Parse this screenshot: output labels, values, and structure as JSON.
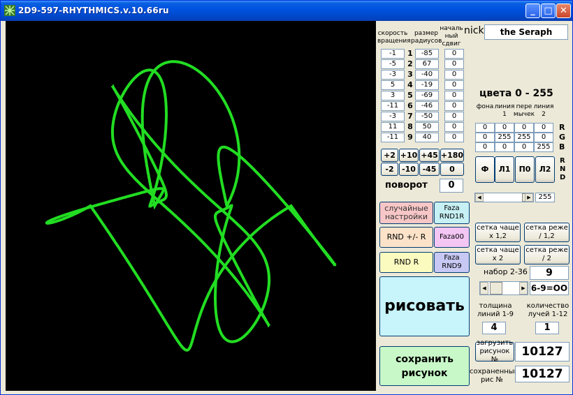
{
  "window": {
    "title": "2D9-597-RHYTHMICS.v.10.66ru"
  },
  "headers": {
    "speed": "скорость вращения",
    "radius": "размер радиусов",
    "shift": "началь ный сдвиг",
    "nick_label": "nick"
  },
  "nick": "the Seraph",
  "rows": [
    {
      "n": "1",
      "speed": "-1",
      "radius": "-85",
      "shift": "0"
    },
    {
      "n": "2",
      "speed": "-5",
      "radius": "67",
      "shift": "0"
    },
    {
      "n": "3",
      "speed": "-3",
      "radius": "-40",
      "shift": "0"
    },
    {
      "n": "4",
      "speed": "5",
      "radius": "-19",
      "shift": "0"
    },
    {
      "n": "5",
      "speed": "3",
      "radius": "-69",
      "shift": "0"
    },
    {
      "n": "6",
      "speed": "-11",
      "radius": "-46",
      "shift": "0"
    },
    {
      "n": "7",
      "speed": "-3",
      "radius": "-50",
      "shift": "0"
    },
    {
      "n": "8",
      "speed": "11",
      "radius": "50",
      "shift": "0"
    },
    {
      "n": "9",
      "speed": "-11",
      "radius": "40",
      "shift": "0"
    }
  ],
  "rotation": {
    "plus": [
      "+2",
      "+10",
      "+45",
      "+180"
    ],
    "minus": [
      "-2",
      "-10",
      "-45",
      "0"
    ],
    "label": "поворот",
    "value": "0"
  },
  "colors": {
    "title": "цвета 0 - 255",
    "col_labels": [
      "фона",
      "линия 1",
      "пере мычек",
      "линия 2"
    ],
    "rgb_letters": [
      "R",
      "G",
      "B"
    ],
    "rnd_letters": [
      "R",
      "N",
      "D"
    ],
    "grid": [
      [
        "0",
        "0",
        "0",
        "0"
      ],
      [
        "0",
        "255",
        "255",
        "0"
      ],
      [
        "0",
        "0",
        "0",
        "255"
      ]
    ],
    "buttons": [
      "Ф",
      "Л1",
      "П0",
      "Л2"
    ],
    "slider_value": "255",
    "line_color": "#22dd22"
  },
  "buttons": {
    "random_settings": "случайные настройки",
    "faza_rnd1r": "Faza RND1R",
    "rnd_pm_r": "RND +/- R",
    "faza00": "Faza00",
    "rnd_r": "RND R",
    "faza_rnd9": "Faza RND9",
    "draw": "рисовать",
    "save": "сохранить рисунок",
    "grid_more_12": "сетка чаще x 1,2",
    "grid_less_12": "сетка реже / 1,2",
    "grid_more_2": "сетка чаще x 2",
    "grid_less_2": "сетка реже / 2",
    "load": "загрузить рисунок №"
  },
  "set": {
    "label": "набор 2-36",
    "value": "9",
    "formula": "6-9=OO"
  },
  "thickness": {
    "label": "толщина линий 1-9",
    "value": "4"
  },
  "rays": {
    "label": "количество лучей 1-12",
    "value": "1"
  },
  "load_value": "10127",
  "saved": {
    "label": "сохраненный рис №",
    "value": "10127"
  }
}
